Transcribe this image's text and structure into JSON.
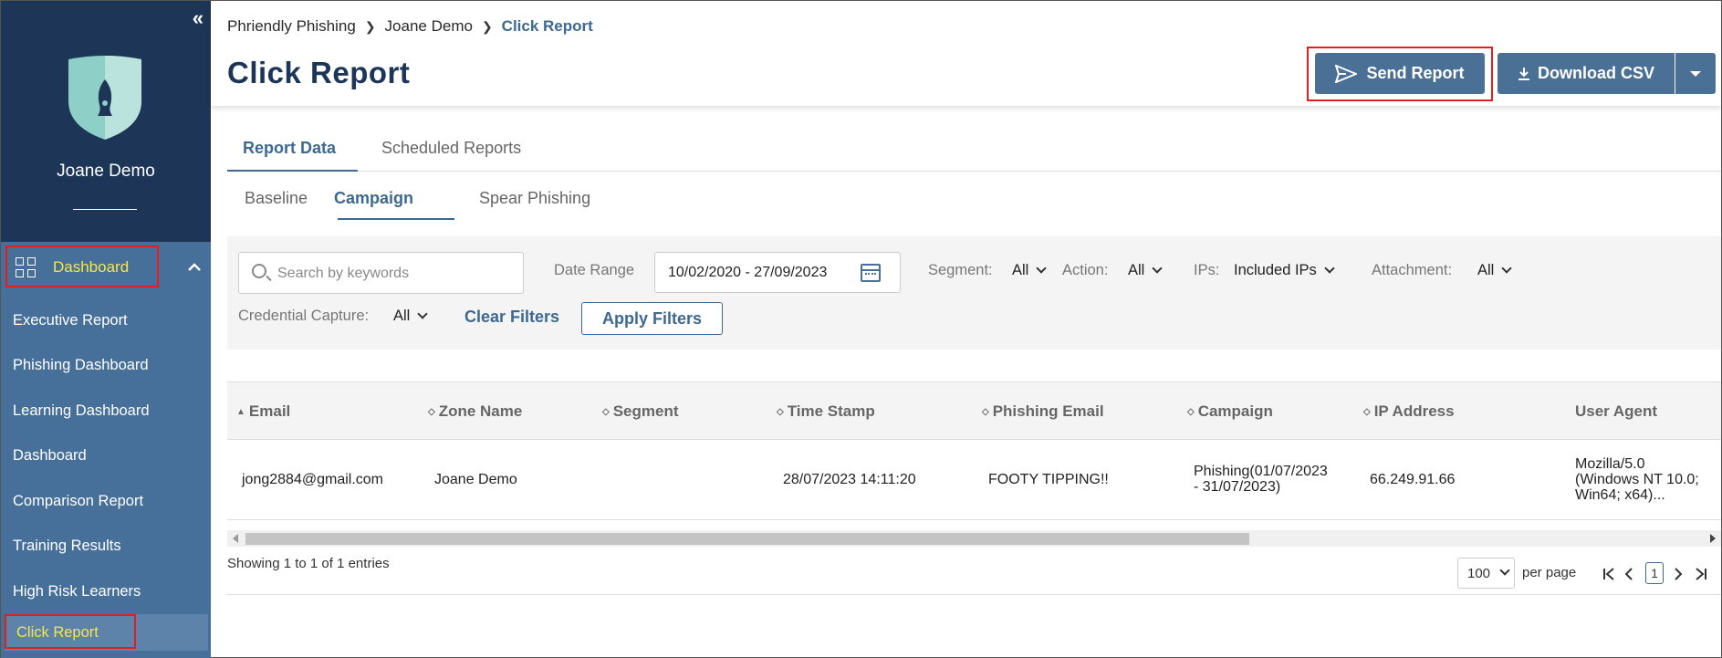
{
  "sidebar": {
    "collapse_glyph": "«",
    "org_name": "Joane Demo",
    "section": {
      "label": "Dashboard",
      "expand_glyph": "⌃"
    },
    "items": [
      {
        "label": "Executive Report"
      },
      {
        "label": "Phishing Dashboard"
      },
      {
        "label": "Learning Dashboard"
      },
      {
        "label": "Dashboard"
      },
      {
        "label": "Comparison Report"
      },
      {
        "label": "Training Results"
      },
      {
        "label": "High Risk Learners"
      },
      {
        "label": "Click Report"
      }
    ]
  },
  "header": {
    "breadcrumb": [
      "Phriendly Phishing",
      "Joane Demo",
      "Click Report"
    ],
    "title": "Click Report",
    "send_label": "Send Report",
    "download_label": "Download CSV"
  },
  "tabs": {
    "primary": [
      "Report Data",
      "Scheduled Reports"
    ],
    "secondary": [
      "Baseline",
      "Campaign",
      "Spear Phishing"
    ]
  },
  "filters": {
    "search_placeholder": "Search by keywords",
    "date_range_label": "Date Range",
    "date_range_value": "10/02/2020 - 27/09/2023",
    "segment_label": "Segment:",
    "segment_value": "All",
    "action_label": "Action:",
    "action_value": "All",
    "ips_label": "IPs:",
    "ips_value": "Included IPs",
    "attachment_label": "Attachment:",
    "attachment_value": "All",
    "credential_label": "Credential Capture:",
    "credential_value": "All",
    "clear_label": "Clear Filters",
    "apply_label": "Apply Filters"
  },
  "table": {
    "columns": [
      "Email",
      "Zone Name",
      "Segment",
      "Time Stamp",
      "Phishing Email",
      "Campaign",
      "IP Address",
      "User Agent"
    ],
    "rows": [
      {
        "email": "jong2884@gmail.com",
        "zone": "Joane Demo",
        "segment": "",
        "timestamp": "28/07/2023 14:11:20",
        "phishing_email": "FOOTY TIPPING!!",
        "campaign_l1": "Phishing(01/07/2023",
        "campaign_l2": "- 31/07/2023)",
        "ip": "66.249.91.66",
        "ua_l1": "Mozilla/5.0",
        "ua_l2": "(Windows NT 10.0;",
        "ua_l3": "Win64; x64)..."
      }
    ],
    "showing": "Showing 1 to 1 of 1 entries",
    "per_page_value": "100",
    "per_page_label": "per page",
    "current_page": "1"
  },
  "colors": {
    "sidebar_dark": "#1d3557",
    "sidebar_nav": "#46709a",
    "accent": "#4b7096",
    "highlight_text": "#f5e64a",
    "annotation_box": "#e02020"
  }
}
